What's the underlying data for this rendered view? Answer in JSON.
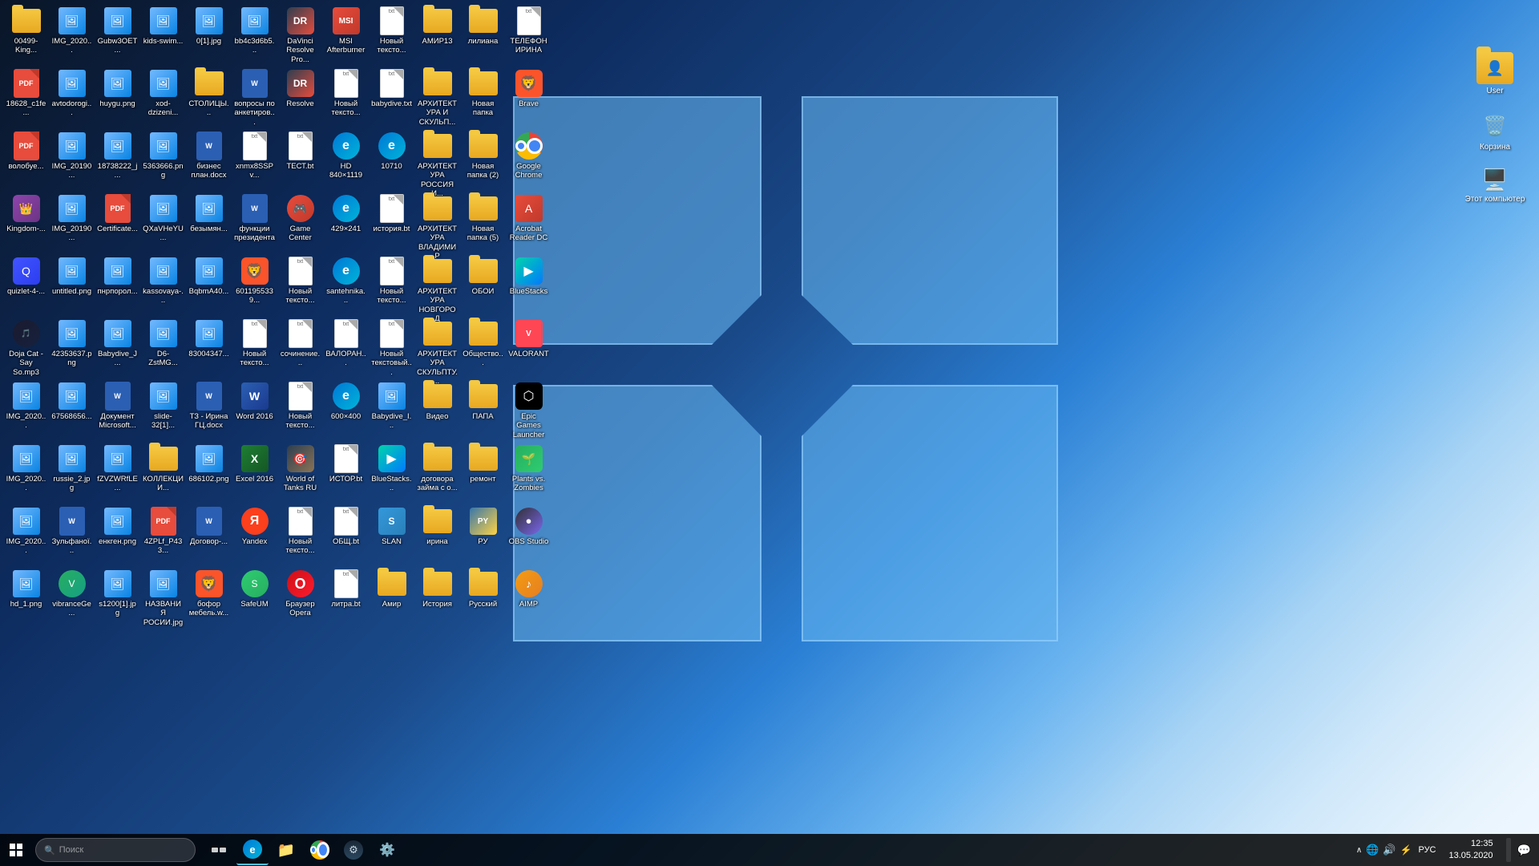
{
  "desktop": {
    "background": "Windows 10 blue gradient",
    "icons": [
      {
        "id": "00499-King",
        "label": "00499-King...",
        "type": "folder",
        "row": 0,
        "col": 0
      },
      {
        "id": "IMG_2020",
        "label": "IMG_2020...",
        "type": "image",
        "row": 0,
        "col": 1
      },
      {
        "id": "Gubw3OET",
        "label": "Gubw3OET...",
        "type": "image",
        "row": 0,
        "col": 2
      },
      {
        "id": "kids-swim",
        "label": "kids-swim...",
        "type": "image",
        "row": 0,
        "col": 3
      },
      {
        "id": "0[1].jpg",
        "label": "0[1].jpg",
        "type": "image",
        "row": 0,
        "col": 4
      },
      {
        "id": "bb4c3d6b5",
        "label": "bb4c3d6b5...",
        "type": "image",
        "row": 0,
        "col": 5
      },
      {
        "id": "DaVinci Resolve Pro",
        "label": "DaVinci Resolve Pro...",
        "type": "app-resolve",
        "row": 0,
        "col": 6
      },
      {
        "id": "MSI Afterburner",
        "label": "MSI Afterburner",
        "type": "app-msi",
        "row": 0,
        "col": 7
      },
      {
        "id": "Новый текстовый",
        "label": "Новый тексто...",
        "type": "txt",
        "row": 0,
        "col": 8
      },
      {
        "id": "АМИР13",
        "label": "АМИР13",
        "type": "folder",
        "row": 0,
        "col": 9
      },
      {
        "id": "лилиана",
        "label": "лилиана",
        "type": "folder",
        "row": 0,
        "col": 10
      },
      {
        "id": "ТЕЛЕФОН ИРИНА",
        "label": "ТЕЛЕФОН ИРИНА",
        "type": "txt",
        "row": 0,
        "col": 11
      },
      {
        "id": "18628_c1fe",
        "label": "18628_c1fe...",
        "type": "pdf",
        "row": 1,
        "col": 0
      },
      {
        "id": "avtodorogi",
        "label": "avtodorogi...",
        "type": "image",
        "row": 1,
        "col": 1
      },
      {
        "id": "huygu.png",
        "label": "huygu.png",
        "type": "image",
        "row": 1,
        "col": 2
      },
      {
        "id": "xod-dzizeni",
        "label": "xod-dzizeni...",
        "type": "image",
        "row": 1,
        "col": 3
      },
      {
        "id": "СТОЛИЦЫ",
        "label": "СТОЛИЦЫ...",
        "type": "folder",
        "row": 1,
        "col": 4
      },
      {
        "id": "вопросы по анкетировании",
        "label": "вопросы по анкетиров...",
        "type": "word",
        "row": 1,
        "col": 5
      },
      {
        "id": "Resolve",
        "label": "Resolve",
        "type": "app-resolve",
        "row": 1,
        "col": 6
      },
      {
        "id": "Новый тексто2",
        "label": "Новый тексто...",
        "type": "txt",
        "row": 1,
        "col": 7
      },
      {
        "id": "babydive.txt",
        "label": "babydive.txt",
        "type": "txt",
        "row": 1,
        "col": 8
      },
      {
        "id": "АРХИТЕКТУРА И СКУЛЬП",
        "label": "АРХИТЕКТУРА И СКУЛЬП...",
        "type": "folder",
        "row": 1,
        "col": 9
      },
      {
        "id": "Новая папка",
        "label": "Новая папка",
        "type": "folder",
        "row": 1,
        "col": 10
      },
      {
        "id": "Brave",
        "label": "Brave",
        "type": "app-brave",
        "row": 1,
        "col": 11
      },
      {
        "id": "волоб",
        "label": "волобуе...",
        "type": "pdf",
        "row": 2,
        "col": 0
      },
      {
        "id": "IMG_20190",
        "label": "IMG_20190...",
        "type": "image",
        "row": 2,
        "col": 1
      },
      {
        "id": "18738222",
        "label": "18738222_j...",
        "type": "image",
        "row": 2,
        "col": 2
      },
      {
        "id": "5363666.png",
        "label": "5363666.png",
        "type": "image",
        "row": 2,
        "col": 3
      },
      {
        "id": "бизнес план.docx",
        "label": "бизнес план.docx",
        "type": "word",
        "row": 2,
        "col": 4
      },
      {
        "id": "xnmx8SSPv",
        "label": "xnmx8SSPv...",
        "type": "txt",
        "row": 2,
        "col": 5
      },
      {
        "id": "ТЕСТ.bt",
        "label": "ТЕСТ.bt",
        "type": "txt",
        "row": 2,
        "col": 6
      },
      {
        "id": "HD 840x1119",
        "label": "HD 840×1119",
        "type": "app-edge",
        "row": 2,
        "col": 7
      },
      {
        "id": "10710",
        "label": "10710",
        "type": "app-edge",
        "row": 2,
        "col": 8
      },
      {
        "id": "АРХИТЕКТУРА РОССИЯ И",
        "label": "АРХИТЕКТУРА РОССИЯ И...",
        "type": "folder",
        "row": 2,
        "col": 9
      },
      {
        "id": "Новая папка 2",
        "label": "Новая папка (2)",
        "type": "folder",
        "row": 2,
        "col": 10
      },
      {
        "id": "Google Chrome",
        "label": "Google Chrome",
        "type": "app-chrome",
        "row": 2,
        "col": 11
      },
      {
        "id": "Kingdom",
        "label": "Kingdom-...",
        "type": "app-kingdom",
        "row": 3,
        "col": 0
      },
      {
        "id": "IMG_201902",
        "label": "IMG_20190...",
        "type": "image",
        "row": 3,
        "col": 1
      },
      {
        "id": "Certificate",
        "label": "Certificate...",
        "type": "pdf",
        "row": 3,
        "col": 2
      },
      {
        "id": "QXaVHeYU",
        "label": "QXaVHeYU...",
        "type": "image",
        "row": 3,
        "col": 3
      },
      {
        "id": "безымян",
        "label": "безымян...",
        "type": "image",
        "row": 3,
        "col": 4
      },
      {
        "id": "функции президента",
        "label": "функции президента",
        "type": "word",
        "row": 3,
        "col": 5
      },
      {
        "id": "Game Center",
        "label": "Game Center",
        "type": "app-game",
        "row": 3,
        "col": 6
      },
      {
        "id": "429x241",
        "label": "429×241",
        "type": "app-edge",
        "row": 3,
        "col": 7
      },
      {
        "id": "история.bt",
        "label": "история.bt",
        "type": "txt",
        "row": 3,
        "col": 8
      },
      {
        "id": "АРХИТЕКТУРА ВЛАДИМИР",
        "label": "АРХИТЕКТУРА ВЛАДИМИР",
        "type": "folder",
        "row": 3,
        "col": 9
      },
      {
        "id": "Новая папка 5",
        "label": "Новая папка (5)",
        "type": "folder",
        "row": 3,
        "col": 10
      },
      {
        "id": "Acrobat Reader DC",
        "label": "Acrobat Reader DC",
        "type": "app-acrobat",
        "row": 3,
        "col": 11
      },
      {
        "id": "quizlet-4",
        "label": "quizlet-4-...",
        "type": "app-quizlet",
        "row": 4,
        "col": 0
      },
      {
        "id": "untitled.png",
        "label": "untitled.png",
        "type": "image",
        "row": 4,
        "col": 1
      },
      {
        "id": "пнрпорол",
        "label": "пнрпорол...",
        "type": "image",
        "row": 4,
        "col": 2
      },
      {
        "id": "kassovaya",
        "label": "kassovaya-...",
        "type": "image",
        "row": 4,
        "col": 3
      },
      {
        "id": "BqbmA40",
        "label": "BqbmA40...",
        "type": "image",
        "row": 4,
        "col": 4
      },
      {
        "id": "6011955339",
        "label": "6011955339...",
        "type": "app-brave",
        "row": 4,
        "col": 5
      },
      {
        "id": "Новый тексто3",
        "label": "Новый тексто...",
        "type": "txt",
        "row": 4,
        "col": 6
      },
      {
        "id": "santehnika",
        "label": "santehnika...",
        "type": "app-edge",
        "row": 4,
        "col": 7
      },
      {
        "id": "Новый тексто4",
        "label": "Новый тексто...",
        "type": "txt",
        "row": 4,
        "col": 8
      },
      {
        "id": "АРХИТЕКТУРА НОВГОРОД",
        "label": "АРХИТЕКТУРА НОВГОРОД",
        "type": "folder",
        "row": 4,
        "col": 9
      },
      {
        "id": "ОБОИ",
        "label": "ОБОИ",
        "type": "folder",
        "row": 4,
        "col": 10
      },
      {
        "id": "BlueStacks",
        "label": "BlueStacks",
        "type": "app-bluestacks",
        "row": 4,
        "col": 11
      },
      {
        "id": "Doja Cat",
        "label": "Doja Cat - Say So.mp3",
        "type": "app-doja",
        "row": 5,
        "col": 0
      },
      {
        "id": "42353637.png",
        "label": "42353637.png",
        "type": "image",
        "row": 5,
        "col": 1
      },
      {
        "id": "Babydive_J",
        "label": "Babydive_J...",
        "type": "image",
        "row": 5,
        "col": 2
      },
      {
        "id": "D6-ZstMG",
        "label": "D6-ZstMG...",
        "type": "image",
        "row": 5,
        "col": 3
      },
      {
        "id": "83004347",
        "label": "83004347...",
        "type": "image",
        "row": 5,
        "col": 4
      },
      {
        "id": "Новый тексто5",
        "label": "Новый тексто...",
        "type": "txt",
        "row": 5,
        "col": 5
      },
      {
        "id": "сочинение",
        "label": "сочинение...",
        "type": "txt",
        "row": 5,
        "col": 6
      },
      {
        "id": "ВАЛОРАН",
        "label": "ВАЛОРАН...",
        "type": "txt",
        "row": 5,
        "col": 7
      },
      {
        "id": "Новый текстовый",
        "label": "Новый текстовый...",
        "type": "txt",
        "row": 5,
        "col": 8
      },
      {
        "id": "АРХИТЕКТУРА СКУЛЬПТУ",
        "label": "АРХИТЕКТУРА СКУЛЬПТУ...",
        "type": "folder",
        "row": 5,
        "col": 9
      },
      {
        "id": "Общество",
        "label": "Общество...",
        "type": "folder",
        "row": 5,
        "col": 10
      },
      {
        "id": "VALORANT",
        "label": "VALORANT",
        "type": "app-valorant",
        "row": 5,
        "col": 11
      },
      {
        "id": "IMG_20200",
        "label": "IMG_2020...",
        "type": "image",
        "row": 6,
        "col": 0
      },
      {
        "id": "67568656",
        "label": "67568656...",
        "type": "image",
        "row": 6,
        "col": 1
      },
      {
        "id": "Документ Microsoft",
        "label": "Документ Microsoft...",
        "type": "word",
        "row": 6,
        "col": 2
      },
      {
        "id": "slide-32[1]",
        "label": "slide-32[1]...",
        "type": "image",
        "row": 6,
        "col": 3
      },
      {
        "id": "ТЗ - Ирина ГЦ.docx",
        "label": "ТЗ - Ирина ГЦ.docx",
        "type": "word",
        "row": 6,
        "col": 4
      },
      {
        "id": "Word 2016",
        "label": "Word 2016",
        "type": "app-word",
        "row": 6,
        "col": 5
      },
      {
        "id": "Новый тексто6",
        "label": "Новый тексто...",
        "type": "txt",
        "row": 6,
        "col": 6
      },
      {
        "id": "600x400",
        "label": "600×400",
        "type": "app-edge",
        "row": 6,
        "col": 7
      },
      {
        "id": "Babydive_I",
        "label": "Babydive_I...",
        "type": "image",
        "row": 6,
        "col": 8
      },
      {
        "id": "Видео",
        "label": "Видео",
        "type": "folder",
        "row": 6,
        "col": 9
      },
      {
        "id": "ПАПА",
        "label": "ПАПА",
        "type": "folder",
        "row": 6,
        "col": 10
      },
      {
        "id": "Epic Games Launcher",
        "label": "Epic Games Launcher",
        "type": "app-epic",
        "row": 6,
        "col": 11
      },
      {
        "id": "IMG_202001",
        "label": "IMG_2020...",
        "type": "image",
        "row": 7,
        "col": 0
      },
      {
        "id": "russie_2.jpg",
        "label": "russie_2.jpg",
        "type": "image",
        "row": 7,
        "col": 1
      },
      {
        "id": "fZVZWRfLE",
        "label": "fZVZWRfLE...",
        "type": "image",
        "row": 7,
        "col": 2
      },
      {
        "id": "КОЛЛЕКЦИИ",
        "label": "КОЛЛЕКЦИИ...",
        "type": "folder",
        "row": 7,
        "col": 3
      },
      {
        "id": "686102.png",
        "label": "686102.png",
        "type": "image",
        "row": 7,
        "col": 4
      },
      {
        "id": "Excel 2016",
        "label": "Excel 2016",
        "type": "app-excel",
        "row": 7,
        "col": 5
      },
      {
        "id": "World of Tanks RU",
        "label": "World of Tanks RU",
        "type": "app-tanks",
        "row": 7,
        "col": 6
      },
      {
        "id": "ИСТОР.bt",
        "label": "ИСТОР.bt",
        "type": "txt",
        "row": 7,
        "col": 7
      },
      {
        "id": "BlueStacks2",
        "label": "BlueStacks...",
        "type": "app-bluestacks",
        "row": 7,
        "col": 8
      },
      {
        "id": "договора займа с о",
        "label": "договора займа с о...",
        "type": "folder",
        "row": 7,
        "col": 9
      },
      {
        "id": "ремонт",
        "label": "ремонт",
        "type": "folder",
        "row": 7,
        "col": 10
      },
      {
        "id": "Plants vs Zombies",
        "label": "Plants vs. Zombies",
        "type": "app-pvz",
        "row": 7,
        "col": 11
      },
      {
        "id": "IMG_202002",
        "label": "IMG_2020...",
        "type": "image",
        "row": 8,
        "col": 0
      },
      {
        "id": "Зульфанои",
        "label": "Зульфаної...",
        "type": "word",
        "row": 8,
        "col": 1
      },
      {
        "id": "енкген.png",
        "label": "енкген.png",
        "type": "image",
        "row": 8,
        "col": 2
      },
      {
        "id": "4ZPLf_P433",
        "label": "4ZPLf_P433...",
        "type": "pdf",
        "row": 8,
        "col": 3
      },
      {
        "id": "Договор-docx",
        "label": "Договор-...",
        "type": "word",
        "row": 8,
        "col": 4
      },
      {
        "id": "Yandex",
        "label": "Yandex",
        "type": "app-yandex",
        "row": 8,
        "col": 5
      },
      {
        "id": "Новый тексто7",
        "label": "Новый тексто...",
        "type": "txt",
        "row": 8,
        "col": 6
      },
      {
        "id": "ОБЩ.bt",
        "label": "ОБЩ.bt",
        "type": "txt",
        "row": 8,
        "col": 7
      },
      {
        "id": "SLAN",
        "label": "SLAN",
        "type": "app-slan",
        "row": 8,
        "col": 8
      },
      {
        "id": "ирина",
        "label": "ирина",
        "type": "folder",
        "row": 8,
        "col": 9
      },
      {
        "id": "РУ",
        "label": "РУ",
        "type": "app-py",
        "row": 8,
        "col": 10
      },
      {
        "id": "OBS Studio",
        "label": "OBS Studio",
        "type": "app-obs",
        "row": 8,
        "col": 11
      },
      {
        "id": "hd_1.png",
        "label": "hd_1.png",
        "type": "image",
        "row": 9,
        "col": 0
      },
      {
        "id": "vibranceGe",
        "label": "vibranceGe...",
        "type": "app-vibrance",
        "row": 9,
        "col": 1
      },
      {
        "id": "s1200[1].jpg",
        "label": "s1200[1].jpg",
        "type": "image",
        "row": 9,
        "col": 2
      },
      {
        "id": "НАЗВАНИЯ РОСИИ.jpg",
        "label": "НАЗВАНИЯ РОСИИ.jpg",
        "type": "image",
        "row": 9,
        "col": 3
      },
      {
        "id": "бофор мебельw",
        "label": "бофор мебель.w...",
        "type": "app-brave",
        "row": 9,
        "col": 4
      },
      {
        "id": "SafeUM",
        "label": "SafeUM",
        "type": "app-safeUM",
        "row": 9,
        "col": 5
      },
      {
        "id": "Браузер Opera",
        "label": "Браузер Opera",
        "type": "app-opera",
        "row": 9,
        "col": 6
      },
      {
        "id": "литра.bt",
        "label": "литра.bt",
        "type": "txt",
        "row": 9,
        "col": 7
      },
      {
        "id": "Амир",
        "label": "Амир",
        "type": "folder",
        "row": 9,
        "col": 8
      },
      {
        "id": "История",
        "label": "История",
        "type": "folder",
        "row": 9,
        "col": 9
      },
      {
        "id": "Русский",
        "label": "Русский",
        "type": "folder",
        "row": 9,
        "col": 10
      },
      {
        "id": "AIMP",
        "label": "AIMP",
        "type": "app-aimp",
        "row": 9,
        "col": 11
      }
    ],
    "right_icons": [
      {
        "id": "User",
        "label": "User",
        "type": "user-folder"
      },
      {
        "id": "Корзина",
        "label": "Корзина",
        "type": "recycle"
      },
      {
        "id": "Этот компьютер",
        "label": "Этот компьютер",
        "type": "computer"
      }
    ]
  },
  "taskbar": {
    "start_label": "Start",
    "search_placeholder": "Search",
    "time": "12:35",
    "date": "13.05.2020",
    "language": "РУС",
    "apps": [
      {
        "id": "edge",
        "label": "Edge",
        "type": "edge"
      },
      {
        "id": "explorer",
        "label": "File Explorer",
        "type": "explorer"
      },
      {
        "id": "chrome",
        "label": "Chrome",
        "type": "chrome"
      },
      {
        "id": "steam",
        "label": "Steam",
        "type": "steam"
      },
      {
        "id": "settings",
        "label": "Settings",
        "type": "settings"
      }
    ]
  }
}
